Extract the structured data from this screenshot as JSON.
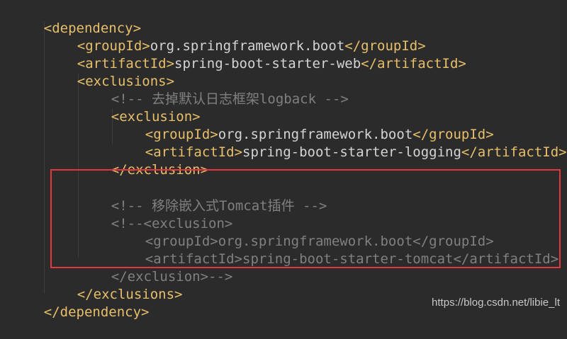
{
  "lines": [
    {
      "tag_open": "<dependency>"
    },
    {
      "tag_open": "<groupId>",
      "text": "org.springframework.boot",
      "tag_close": "</groupId>"
    },
    {
      "tag_open": "<artifactId>",
      "text": "spring-boot-starter-web",
      "tag_close": "</artifactId>"
    },
    {
      "tag_open": "<exclusions>"
    },
    {
      "comment": "<!-- 去掉默认日志框架logback -->"
    },
    {
      "tag_open": "<exclusion>"
    },
    {
      "tag_open": "<groupId>",
      "text": "org.springframework.boot",
      "tag_close": "</groupId>"
    },
    {
      "tag_open": "<artifactId>",
      "text": "spring-boot-starter-logging",
      "tag_close": "</artifactId>"
    },
    {
      "tag_open": "</exclusion>"
    },
    {
      "comment": "<!-- 移除嵌入式Tomcat插件 -->"
    },
    {
      "comment": "<!--<exclusion>"
    },
    {
      "comment": "<groupId>org.springframework.boot</groupId>"
    },
    {
      "comment": "<artifactId>spring-boot-starter-tomcat</artifactId>"
    },
    {
      "comment": "</exclusion>-->"
    },
    {
      "tag_open": "</exclusions>"
    },
    {
      "tag_open": "</dependency>"
    }
  ],
  "watermark": "https://blog.csdn.net/libie_lt",
  "colors": {
    "background": "#2b2b2b",
    "tag": "#e8bf6a",
    "text": "#d4d4d4",
    "comment": "#808080",
    "highlight_border": "#e0383e"
  }
}
